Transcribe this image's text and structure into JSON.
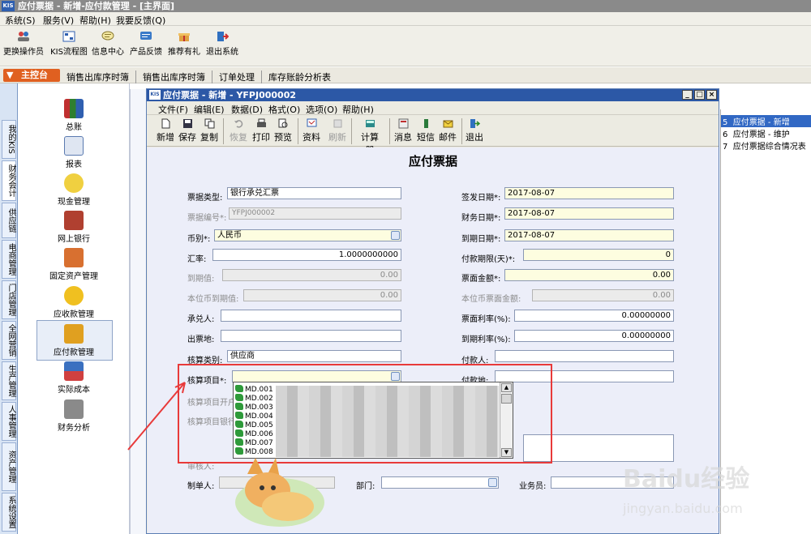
{
  "outer": {
    "title": "应付票据 - 新增-应付款管理 - [主界面]",
    "logo": "KIS",
    "menu": [
      "系统(S)",
      "服务(V)",
      "帮助(H)",
      "我要反馈(Q)"
    ],
    "toolbar": [
      "更换操作员",
      "KIS流程图",
      "信息中心",
      "产品反馈",
      "推荐有礼",
      "退出系统"
    ],
    "nav": {
      "home": "主控台",
      "tabs": [
        "销售出库序时簿",
        "销售出库序时簿",
        "订单处理",
        "库存账龄分析表"
      ]
    }
  },
  "sidetabs": [
    "我的KIS",
    "财务会计",
    "供应链",
    "电商管理",
    "门店管理",
    "全网营销",
    "生产管理",
    "人事管理",
    "资产管理",
    "系统设置"
  ],
  "modules": [
    "总账",
    "报表",
    "现金管理",
    "网上银行",
    "固定资产管理",
    "应收款管理",
    "应付款管理",
    "实际成本",
    "财务分析"
  ],
  "right_panel": [
    {
      "num": "5",
      "label": "应付票据 - 新增"
    },
    {
      "num": "6",
      "label": "应付票据 - 维护"
    },
    {
      "num": "7",
      "label": "应付票据综合情况表"
    }
  ],
  "window": {
    "title": "应付票据 - 新增 - YFPJ000002",
    "logo": "KIS",
    "menu": [
      "文件(F)",
      "编辑(E)",
      "数据(D)",
      "格式(O)",
      "选项(O)",
      "帮助(H)"
    ],
    "tools": [
      "新增",
      "保存",
      "复制",
      "恢复",
      "打印",
      "预览",
      "资料",
      "刷新",
      "计算器",
      "消息",
      "短信",
      "邮件",
      "退出"
    ],
    "tools_disabled": [
      "恢复",
      "刷新"
    ]
  },
  "form": {
    "title": "应付票据",
    "bill_type": {
      "label": "票据类型:",
      "value": "银行承兑汇票"
    },
    "bill_no": {
      "label": "票据编号*:",
      "value": "YFPJ000002"
    },
    "currency": {
      "label": "币别*:",
      "value": "人民币"
    },
    "rate": {
      "label": "汇率:",
      "value": "1.0000000000"
    },
    "maturity_value": {
      "label": "到期值:",
      "value": "0.00"
    },
    "local_maturity": {
      "label": "本位币到期值:",
      "value": "0.00"
    },
    "acceptor": {
      "label": "承兑人:",
      "value": ""
    },
    "issue_place": {
      "label": "出票地:",
      "value": ""
    },
    "acct_type": {
      "label": "核算类别:",
      "value": "供应商"
    },
    "acct_item": {
      "label": "核算项目*:",
      "value": ""
    },
    "acct_bank_open": {
      "label": "核算项目开户"
    },
    "acct_bank_acct": {
      "label": "核算项目银行"
    },
    "issue_date": {
      "label": "签发日期*:",
      "value": "2017-08-07"
    },
    "fin_date": {
      "label": "财务日期*:",
      "value": "2017-08-07"
    },
    "due_date": {
      "label": "到期日期*:",
      "value": "2017-08-07"
    },
    "pay_term": {
      "label": "付款期限(天)*:",
      "value": "0"
    },
    "face_amount": {
      "label": "票面金额*:",
      "value": "0.00"
    },
    "local_face": {
      "label": "本位币票面金额:",
      "value": "0.00"
    },
    "face_rate": {
      "label": "票面利率(%):",
      "value": "0.00000000"
    },
    "due_rate": {
      "label": "到期利率(%):",
      "value": "0.00000000"
    },
    "payer": {
      "label": "付款人:",
      "value": ""
    },
    "pay_place": {
      "label": "付款地:",
      "value": ""
    },
    "auditor": {
      "label": "审核人:"
    },
    "maker": {
      "label": "制单人:",
      "value": ""
    },
    "dept": {
      "label": "部门:",
      "value": ""
    },
    "salesman": {
      "label": "业务员:",
      "value": ""
    }
  },
  "dropdown": {
    "items": [
      "MD.001",
      "MD.002",
      "MD.003",
      "MD.004",
      "MD.005",
      "MD.006",
      "MD.007",
      "MD.008"
    ]
  },
  "watermark": {
    "brand": "Baidu经验",
    "url": "jingyan.baidu.com"
  },
  "colors": {
    "highlight": "#e83a3a",
    "title_bar": "#2c58a6",
    "home_tab": "#e06020",
    "selected": "#3168c4"
  }
}
